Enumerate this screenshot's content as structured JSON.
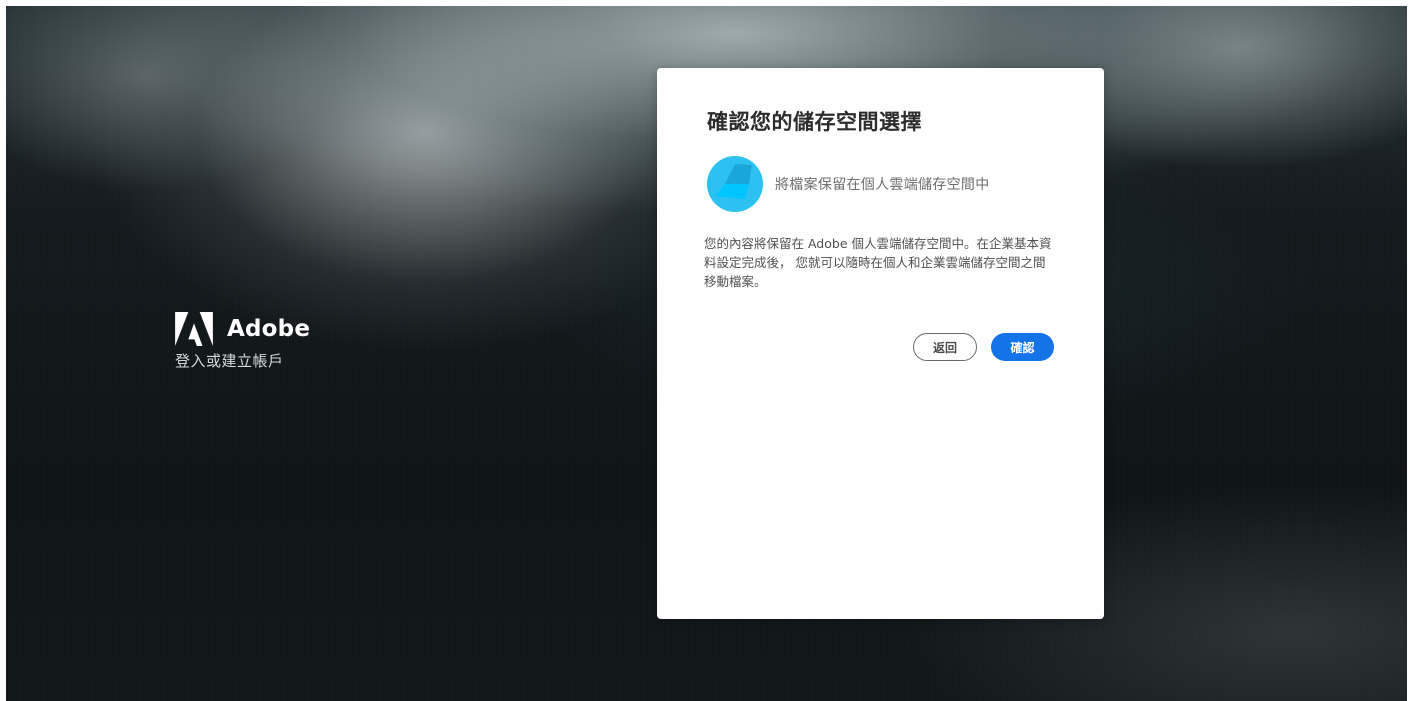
{
  "brand": {
    "name": "Adobe",
    "subtitle": "登入或建立帳戶",
    "logo_icon": "adobe-logo-icon"
  },
  "dialog": {
    "title": "確認您的儲存空間選擇",
    "option": {
      "icon": "cloud-storage-icon",
      "label": "將檔案保留在個人雲端儲存空間中"
    },
    "description": "您的內容將保留在 Adobe 個人雲端儲存空間中。在企業基本資料設定完成後， 您就可以隨時在個人和企業雲端儲存空間之間移動檔案。",
    "buttons": {
      "back_label": "返回",
      "confirm_label": "確認"
    }
  },
  "colors": {
    "accent": "#1473e6",
    "icon_light": "#2cc1f0",
    "icon_dark": "#1aa6d9",
    "card_background": "#ffffff",
    "page_background": "#141a1d"
  }
}
